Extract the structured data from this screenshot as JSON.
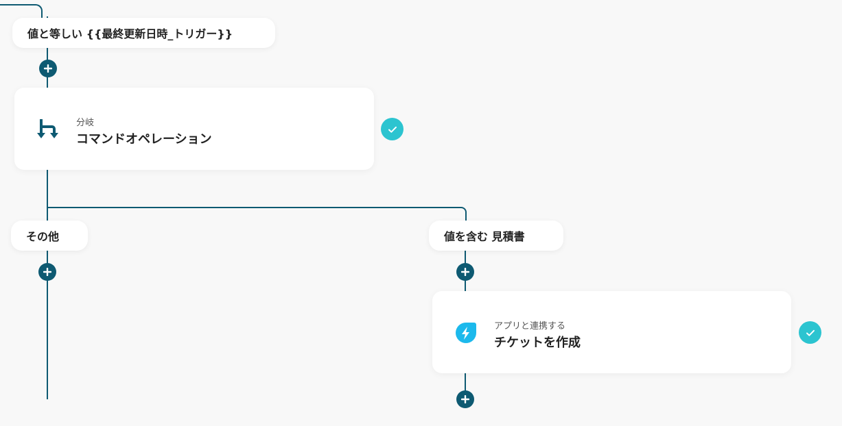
{
  "colors": {
    "connector": "#0e5a72",
    "check": "#2cc4d0",
    "app_icon": "#1cb9ec",
    "background": "#f8f8f8"
  },
  "conditions": {
    "top": "値と等しい {{最終更新日時_トリガー}}",
    "other": "その他",
    "contains": "値を含む 見積書"
  },
  "steps": {
    "branch": {
      "category": "分岐",
      "title": "コマンドオペレーション",
      "icon": "branch-icon",
      "status_icon": "check-icon"
    },
    "ticket": {
      "category": "アプリと連携する",
      "title": "チケットを作成",
      "icon": "freshdesk-lightning-icon",
      "status_icon": "check-icon"
    }
  },
  "add_buttons": [
    "plus-icon",
    "plus-icon",
    "plus-icon",
    "plus-icon"
  ]
}
